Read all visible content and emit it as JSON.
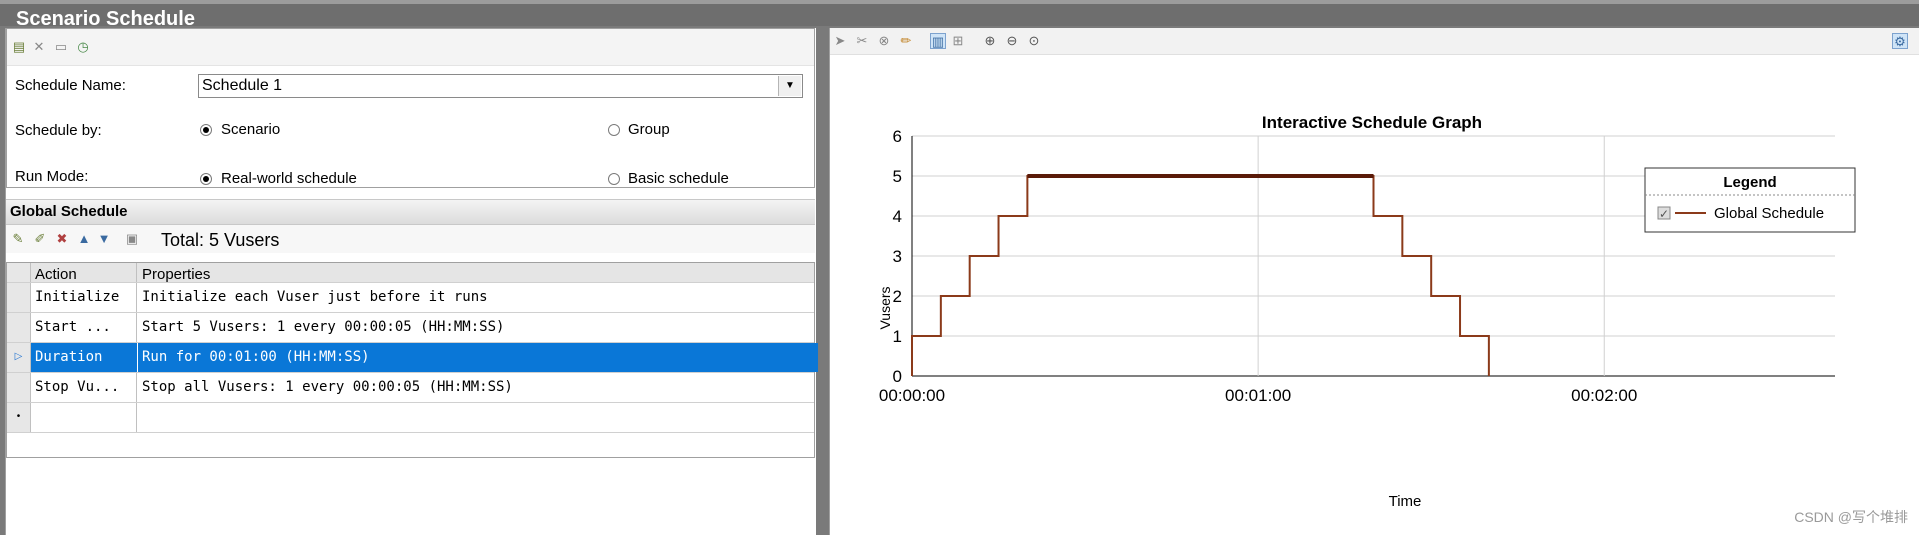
{
  "window": {
    "title": "Scenario Schedule"
  },
  "schedule_form": {
    "name_label": "Schedule Name:",
    "name_value": "Schedule 1",
    "by_label": "Schedule by:",
    "by_options": [
      "Scenario",
      "Group"
    ],
    "by_selected": "Scenario",
    "run_mode_label": "Run Mode:",
    "run_mode_options": [
      "Real-world schedule",
      "Basic schedule"
    ],
    "run_mode_selected": "Real-world schedule"
  },
  "global_schedule": {
    "title": "Global Schedule",
    "total": "Total: 5 Vusers",
    "columns": [
      "Action",
      "Properties"
    ],
    "rows": [
      {
        "action": "Initialize",
        "properties": "Initialize each Vuser just before it runs"
      },
      {
        "action": "Start  ...",
        "properties": "Start 5 Vusers: 1 every 00:00:05 (HH:MM:SS)"
      },
      {
        "action": "Duration",
        "properties": "Run for 00:01:00 (HH:MM:SS)",
        "selected": true
      },
      {
        "action": "Stop Vu...",
        "properties": "Stop all Vusers: 1 every 00:00:05 (HH:MM:SS)"
      }
    ]
  },
  "chart_data": {
    "type": "line",
    "title": "Interactive Schedule Graph",
    "xlabel": "Time",
    "ylabel": "Vusers",
    "x_ticks": [
      "00:00:00",
      "00:01:00",
      "00:02:00"
    ],
    "xlim_seconds": [
      0,
      160
    ],
    "ylim": [
      0,
      6
    ],
    "y_ticks": [
      0,
      1,
      2,
      3,
      4,
      5,
      6
    ],
    "legend": {
      "title": "Legend",
      "position": "top-right"
    },
    "series": [
      {
        "name": "Global Schedule",
        "color": "#8b3a1a",
        "x_seconds": [
          0,
          0,
          5,
          5,
          10,
          10,
          15,
          15,
          20,
          20,
          80,
          80,
          85,
          85,
          90,
          90,
          95,
          95,
          100,
          100
        ],
        "y": [
          0,
          1,
          1,
          2,
          2,
          3,
          3,
          4,
          4,
          5,
          5,
          4,
          4,
          3,
          3,
          2,
          2,
          1,
          1,
          0
        ]
      }
    ],
    "highlight_segment": {
      "x_seconds": [
        20,
        80
      ],
      "y": 5,
      "color": "#5a1a08"
    },
    "grid": true
  },
  "watermark": "CSDN @写个堆排"
}
